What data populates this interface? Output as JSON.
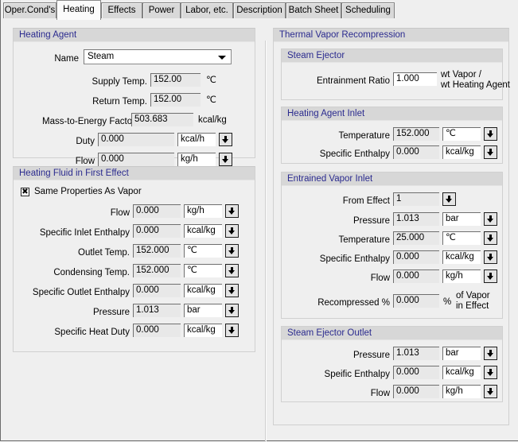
{
  "window": {
    "tabs": [
      {
        "label": "Oper.Cond's",
        "active": false
      },
      {
        "label": "Heating",
        "active": true
      },
      {
        "label": "Effects",
        "active": false
      },
      {
        "label": "Power",
        "active": false
      },
      {
        "label": "Labor, etc.",
        "active": false
      },
      {
        "label": "Description",
        "active": false
      },
      {
        "label": "Batch Sheet",
        "active": false
      },
      {
        "label": "Scheduling",
        "active": false
      }
    ]
  },
  "colors": {
    "group_title": "#2b2b8f",
    "group_header_bg": "#d7d7d7",
    "page_bg": "#efefef",
    "readonly_field_bg": "#e8e8e8",
    "editable_field_bg": "#ffffff"
  },
  "heating_agent": {
    "title": "Heating Agent",
    "name_label": "Name",
    "name_value": "Steam",
    "supply_temp_label": "Supply Temp.",
    "supply_temp_value": "152.00",
    "supply_temp_unit": "℃",
    "return_temp_label": "Return Temp.",
    "return_temp_value": "152.00",
    "return_temp_unit": "℃",
    "mass_energy_label": "Mass-to-Energy Factor",
    "mass_energy_value": "503.683",
    "mass_energy_unit": "kcal/kg",
    "duty_label": "Duty",
    "duty_value": "0.000",
    "duty_unit": "kcal/h",
    "flow_label": "Flow",
    "flow_value": "0.000",
    "flow_unit": "kg/h"
  },
  "heating_fluid": {
    "title": "Heating Fluid in First Effect",
    "same_props_label": "Same Properties As Vapor",
    "same_props_checked": true,
    "rows": [
      {
        "label": "Flow",
        "value": "0.000",
        "unit": "kg/h"
      },
      {
        "label": "Specific Inlet Enthalpy",
        "value": "0.000",
        "unit": "kcal/kg"
      },
      {
        "label": "Outlet Temp.",
        "value": "152.000",
        "unit": "℃"
      },
      {
        "label": "Condensing Temp.",
        "value": "152.000",
        "unit": "℃"
      },
      {
        "label": "Specific Outlet Enthalpy",
        "value": "0.000",
        "unit": "kcal/kg"
      },
      {
        "label": "Pressure",
        "value": "1.013",
        "unit": "bar"
      },
      {
        "label": "Specific Heat Duty",
        "value": "0.000",
        "unit": "kcal/kg"
      }
    ]
  },
  "tvr": {
    "title": "Thermal Vapor Recompression",
    "steam_ejector": {
      "title": "Steam Ejector",
      "entrainment_label": "Entrainment Ratio",
      "entrainment_value": "1.000",
      "entrainment_unit_line1": "wt Vapor /",
      "entrainment_unit_line2": "wt Heating Agent"
    },
    "heating_agent_inlet": {
      "title": "Heating Agent Inlet",
      "rows": [
        {
          "label": "Temperature",
          "value": "152.000",
          "unit": "℃"
        },
        {
          "label": "Specific Enthalpy",
          "value": "0.000",
          "unit": "kcal/kg"
        }
      ]
    },
    "entrained_vapor_inlet": {
      "title": "Entrained Vapor Inlet",
      "from_effect_label": "From Effect",
      "from_effect_value": "1",
      "rows": [
        {
          "label": "Pressure",
          "value": "1.013",
          "unit": "bar"
        },
        {
          "label": "Temperature",
          "value": "25.000",
          "unit": "℃"
        },
        {
          "label": "Specific Enthalpy",
          "value": "0.000",
          "unit": "kcal/kg"
        },
        {
          "label": "Flow",
          "value": "0.000",
          "unit": "kg/h"
        }
      ],
      "recompressed_label": "Recompressed %",
      "recompressed_value": "0.000",
      "recompressed_pct": "%",
      "recompressed_unit_line1": "of Vapor",
      "recompressed_unit_line2": "in Effect"
    },
    "steam_ejector_outlet": {
      "title": "Steam Ejector Outlet",
      "rows": [
        {
          "label": "Pressure",
          "value": "1.013",
          "unit": "bar"
        },
        {
          "label": "Speific Enthalpy",
          "value": "0.000",
          "unit": "kcal/kg"
        },
        {
          "label": "Flow",
          "value": "0.000",
          "unit": "kg/h"
        }
      ]
    }
  }
}
